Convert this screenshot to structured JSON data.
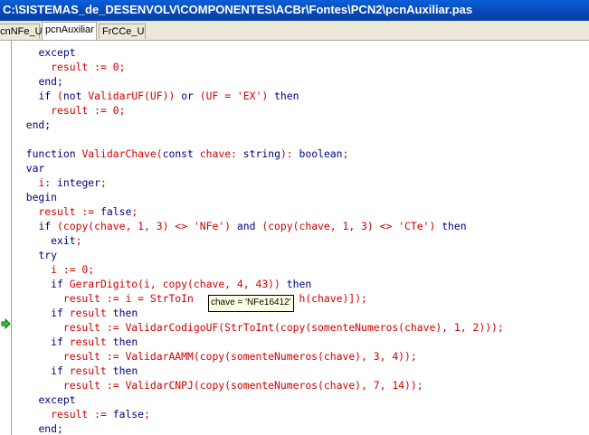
{
  "window": {
    "title": "C:\\SISTEMAS_de_DESENVOLV\\COMPONENTES\\ACBr\\Fontes\\PCN2\\pcnAuxiliar.pas"
  },
  "tabs": [
    {
      "label": "pcnNFe_U"
    },
    {
      "label": "pcnAuxiliar"
    },
    {
      "label": "FrCCe_U"
    }
  ],
  "tooltip": {
    "text": "chave = 'NFe16412'"
  },
  "colors": {
    "keyword": "#000080",
    "identifier": "#d00000",
    "title_bar": "#0747b8"
  },
  "code": {
    "lines": [
      [
        [
          "    ",
          "id"
        ],
        [
          "except",
          "kw"
        ]
      ],
      [
        [
          "      ",
          "id"
        ],
        [
          "result := 0;",
          "id"
        ]
      ],
      [
        [
          "    ",
          "id"
        ],
        [
          "end;",
          "kw"
        ]
      ],
      [
        [
          "    ",
          "id"
        ],
        [
          "if",
          "kw"
        ],
        [
          " (",
          "id"
        ],
        [
          "not",
          "kw"
        ],
        [
          " ValidarUF(UF)) ",
          "id"
        ],
        [
          "or",
          "kw"
        ],
        [
          " (UF = 'EX') ",
          "id"
        ],
        [
          "then",
          "kw"
        ]
      ],
      [
        [
          "      ",
          "id"
        ],
        [
          "result := 0;",
          "id"
        ]
      ],
      [
        [
          "  ",
          "id"
        ],
        [
          "end;",
          "kw"
        ]
      ],
      [],
      [
        [
          "  ",
          "id"
        ],
        [
          "function",
          "kw"
        ],
        [
          " ValidarChave(",
          "id"
        ],
        [
          "const",
          "kw"
        ],
        [
          " chave: ",
          "id"
        ],
        [
          "string",
          "kw"
        ],
        [
          "): ",
          "id"
        ],
        [
          "boolean",
          "kw"
        ],
        [
          ";",
          "id"
        ]
      ],
      [
        [
          "  ",
          "id"
        ],
        [
          "var",
          "kw"
        ]
      ],
      [
        [
          "    i: ",
          "id"
        ],
        [
          "integer",
          "kw"
        ],
        [
          ";",
          "id"
        ]
      ],
      [
        [
          "  ",
          "id"
        ],
        [
          "begin",
          "kw"
        ]
      ],
      [
        [
          "    result := ",
          "id"
        ],
        [
          "false",
          "kw"
        ],
        [
          ";",
          "id"
        ]
      ],
      [
        [
          "    ",
          "id"
        ],
        [
          "if",
          "kw"
        ],
        [
          " (copy(chave, 1, 3) <> 'NFe') ",
          "id"
        ],
        [
          "and",
          "kw"
        ],
        [
          " (copy(chave, 1, 3) <> 'CTe') ",
          "id"
        ],
        [
          "then",
          "kw"
        ]
      ],
      [
        [
          "      ",
          "id"
        ],
        [
          "exit",
          "kw"
        ],
        [
          ";",
          "id"
        ]
      ],
      [
        [
          "    ",
          "id"
        ],
        [
          "try",
          "kw"
        ]
      ],
      [
        [
          "      i := 0;",
          "id"
        ]
      ],
      [
        [
          "      ",
          "id"
        ],
        [
          "if",
          "kw"
        ],
        [
          " GerarDigito(i, copy(chave, 4, 43)) ",
          "id"
        ],
        [
          "then",
          "kw"
        ]
      ],
      [
        [
          "        result := i = StrToIn",
          "id"
        ],
        [
          "                 ",
          "id"
        ],
        [
          "h(chave)]);",
          "id"
        ]
      ],
      [
        [
          "      ",
          "id"
        ],
        [
          "if",
          "kw"
        ],
        [
          " result ",
          "id"
        ],
        [
          "then",
          "kw"
        ]
      ],
      [
        [
          "        result := ValidarCodigoUF(StrToInt(copy(somenteNumeros(chave), 1, 2)));",
          "id"
        ]
      ],
      [
        [
          "      ",
          "id"
        ],
        [
          "if",
          "kw"
        ],
        [
          " result ",
          "id"
        ],
        [
          "then",
          "kw"
        ]
      ],
      [
        [
          "        result := ValidarAAMM(copy(somenteNumeros(chave), 3, 4));",
          "id"
        ]
      ],
      [
        [
          "      ",
          "id"
        ],
        [
          "if",
          "kw"
        ],
        [
          " result ",
          "id"
        ],
        [
          "then",
          "kw"
        ]
      ],
      [
        [
          "        result := ValidarCNPJ(copy(somenteNumeros(chave), 7, 14));",
          "id"
        ]
      ],
      [
        [
          "    ",
          "id"
        ],
        [
          "except",
          "kw"
        ]
      ],
      [
        [
          "      result := ",
          "id"
        ],
        [
          "false",
          "kw"
        ],
        [
          ";",
          "id"
        ]
      ],
      [
        [
          "    ",
          "id"
        ],
        [
          "end;",
          "kw"
        ]
      ]
    ]
  }
}
